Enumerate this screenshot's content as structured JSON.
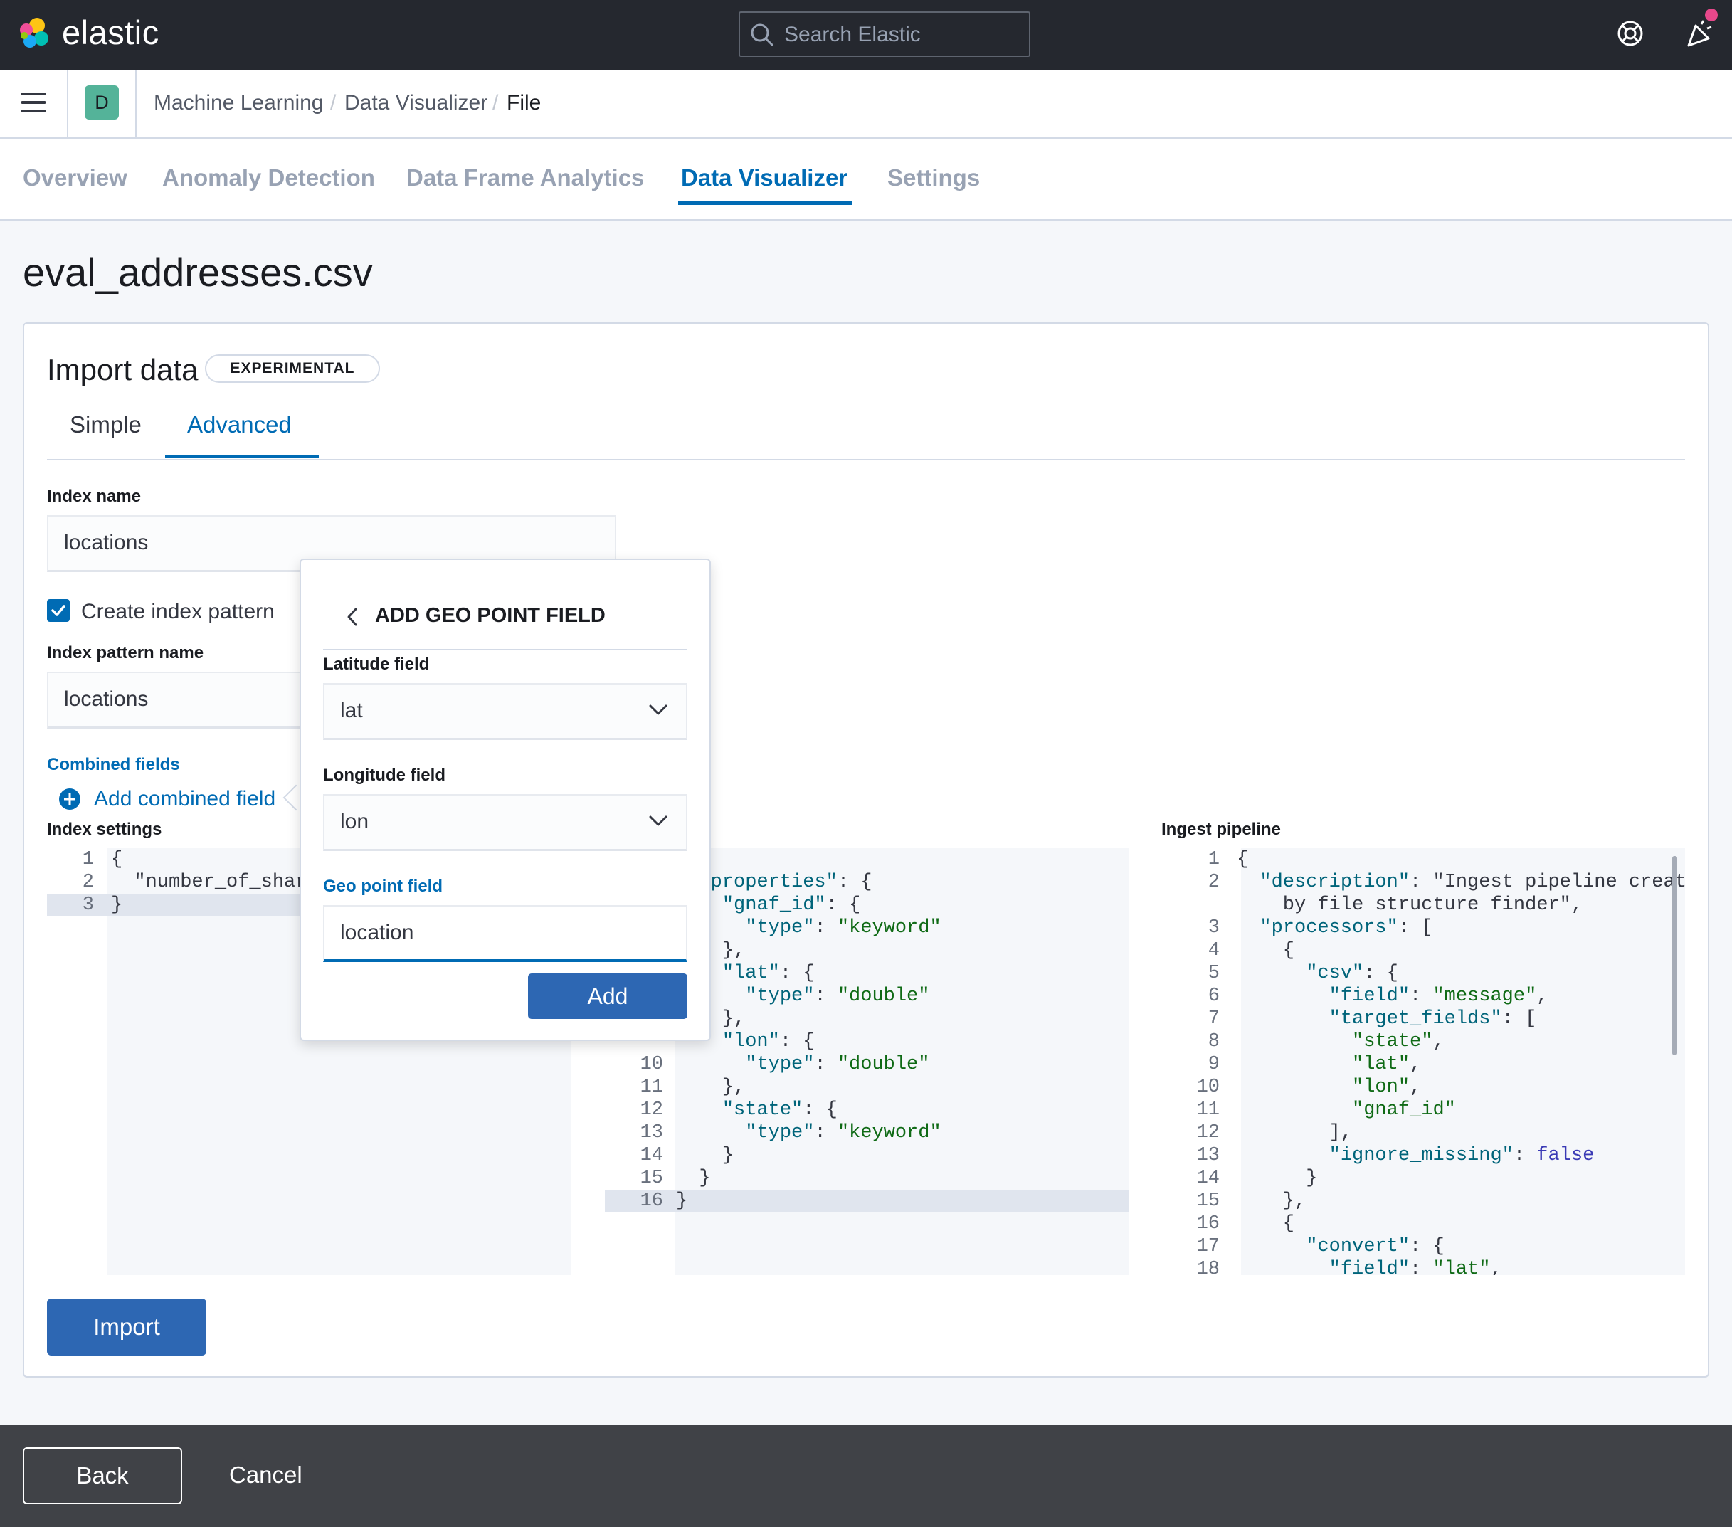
{
  "topbar": {
    "brand": "elastic",
    "search_placeholder": "Search Elastic",
    "accent_dot_color": "#e7488b"
  },
  "navbar": {
    "space_initial": "D",
    "breadcrumbs": [
      "Machine Learning",
      "Data Visualizer",
      "File"
    ]
  },
  "tabs": [
    "Overview",
    "Anomaly Detection",
    "Data Frame Analytics",
    "Data Visualizer",
    "Settings"
  ],
  "active_tab": "Data Visualizer",
  "page": {
    "title": "eval_addresses.csv",
    "import_title": "Import data",
    "badge": "EXPERIMENTAL",
    "subtabs": [
      "Simple",
      "Advanced"
    ],
    "active_subtab": "Advanced"
  },
  "form": {
    "index_name_label": "Index name",
    "index_name_value": "locations",
    "create_index_pattern_label": "Create index pattern",
    "create_index_pattern_checked": true,
    "index_pattern_name_label": "Index pattern name",
    "index_pattern_name_value": "locations",
    "combined_fields_label": "Combined fields",
    "add_combined_field": "Add combined field",
    "index_settings_label": "Index settings",
    "ingest_pipeline_label": "Ingest pipeline"
  },
  "editors": {
    "settings": [
      {
        "n": "1",
        "text": "{"
      },
      {
        "n": "2",
        "text": "  \"number_of_shards"
      },
      {
        "n": "3",
        "text": "}"
      }
    ],
    "mappings": [
      {
        "n": "",
        "text": "  \"properties\": {"
      },
      {
        "n": "",
        "text": "    \"gnaf_id\": {"
      },
      {
        "n": "",
        "text": "      \"type\": \"keyword\""
      },
      {
        "n": "",
        "text": "    },"
      },
      {
        "n": "",
        "text": "    \"lat\": {"
      },
      {
        "n": "",
        "text": "      \"type\": \"double\""
      },
      {
        "n": "",
        "text": "    },"
      },
      {
        "n": "",
        "text": "    \"lon\": {"
      },
      {
        "n": "10",
        "text": "      \"type\": \"double\""
      },
      {
        "n": "11",
        "text": "    },"
      },
      {
        "n": "12",
        "text": "    \"state\": {"
      },
      {
        "n": "13",
        "text": "      \"type\": \"keyword\""
      },
      {
        "n": "14",
        "text": "    }"
      },
      {
        "n": "15",
        "text": "  }"
      },
      {
        "n": "16",
        "text": "}"
      }
    ],
    "pipeline": [
      {
        "n": "1",
        "text": "{"
      },
      {
        "n": "2",
        "text": "  \"description\": \"Ingest pipeline created"
      },
      {
        "n": "",
        "text": "    by file structure finder\","
      },
      {
        "n": "3",
        "text": "  \"processors\": ["
      },
      {
        "n": "4",
        "text": "    {"
      },
      {
        "n": "5",
        "text": "      \"csv\": {"
      },
      {
        "n": "6",
        "text": "        \"field\": \"message\","
      },
      {
        "n": "7",
        "text": "        \"target_fields\": ["
      },
      {
        "n": "8",
        "text": "          \"state\","
      },
      {
        "n": "9",
        "text": "          \"lat\","
      },
      {
        "n": "10",
        "text": "          \"lon\","
      },
      {
        "n": "11",
        "text": "          \"gnaf_id\""
      },
      {
        "n": "12",
        "text": "        ],"
      },
      {
        "n": "13",
        "text": "        \"ignore_missing\": false"
      },
      {
        "n": "14",
        "text": "      }"
      },
      {
        "n": "15",
        "text": "    },"
      },
      {
        "n": "16",
        "text": "    {"
      },
      {
        "n": "17",
        "text": "      \"convert\": {"
      },
      {
        "n": "18",
        "text": "        \"field\": \"lat\","
      }
    ]
  },
  "popover": {
    "title": "ADD GEO POINT FIELD",
    "latitude_label": "Latitude field",
    "latitude_value": "lat",
    "longitude_label": "Longitude field",
    "longitude_value": "lon",
    "geo_label": "Geo point field",
    "geo_value": "location",
    "add_button": "Add"
  },
  "buttons": {
    "import": "Import",
    "back": "Back",
    "cancel": "Cancel"
  },
  "colors": {
    "primary": "#006bb4",
    "button": "#2d67b3",
    "header": "#25282f",
    "footer": "#404247"
  }
}
